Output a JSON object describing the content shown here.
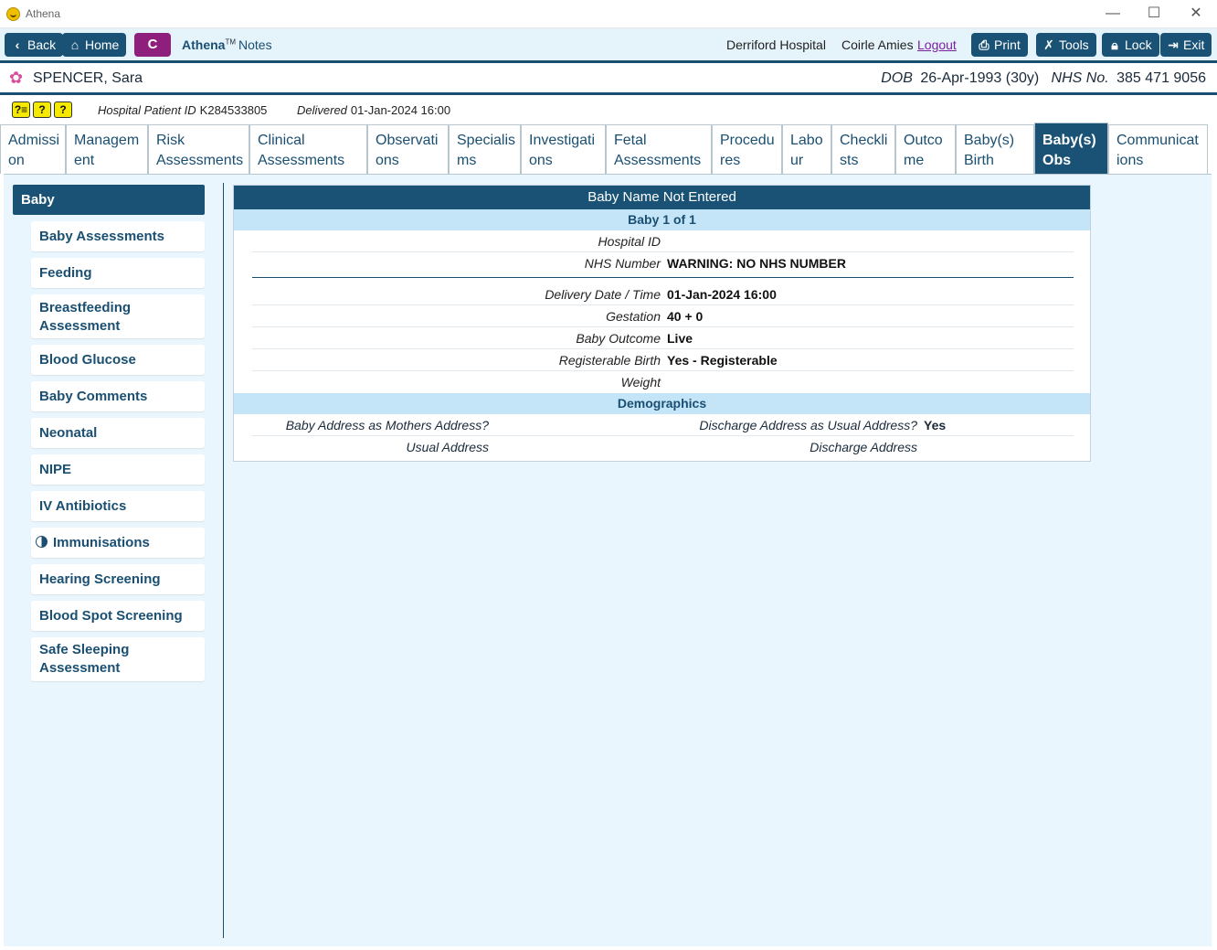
{
  "window": {
    "title": "Athena",
    "minimize": "—",
    "maximize": "☐",
    "close": "✕"
  },
  "toolbar": {
    "back": "Back",
    "home": "Home",
    "c_button": "C",
    "app_name": "Athena",
    "tm": "TM",
    "module": "Notes",
    "hospital": "Derriford Hospital",
    "user": "Coirle Amies",
    "logout": "Logout",
    "print": "Print",
    "tools": "Tools",
    "lock": "Lock",
    "exit": "Exit"
  },
  "patient": {
    "name": "SPENCER, Sara",
    "dob_label": "DOB",
    "dob": "26-Apr-1993 (30y)",
    "nhs_label": "NHS No.",
    "nhs": "385 471 9056",
    "hospital_id_label": "Hospital Patient ID",
    "hospital_id": "K284533805",
    "delivered_label": "Delivered",
    "delivered": "01-Jan-2024 16:00"
  },
  "tabs": [
    {
      "line1": "Admissi",
      "line2": "on"
    },
    {
      "line1": "Managem",
      "line2": "ent"
    },
    {
      "line1": "Risk",
      "line2": "Assessments"
    },
    {
      "line1": "Clinical",
      "line2": "Assessments"
    },
    {
      "line1": "Observati",
      "line2": "ons"
    },
    {
      "line1": "Specialis",
      "line2": "ms"
    },
    {
      "line1": "Investigati",
      "line2": "ons"
    },
    {
      "line1": "Fetal",
      "line2": "Assessments"
    },
    {
      "line1": "Procedu",
      "line2": "res"
    },
    {
      "line1": "Labo",
      "line2": "ur"
    },
    {
      "line1": "Checkli",
      "line2": "sts"
    },
    {
      "line1": "Outco",
      "line2": "me"
    },
    {
      "line1": "Baby(s)",
      "line2": "Birth"
    },
    {
      "line1": "Baby(s)",
      "line2": "Obs"
    },
    {
      "line1": "Communicat",
      "line2": "ions"
    }
  ],
  "sidebar": {
    "header": "Baby",
    "items": [
      {
        "line1": "Baby Assessments",
        "line2": ""
      },
      {
        "line1": "Feeding",
        "line2": ""
      },
      {
        "line1": "Breastfeeding",
        "line2": "Assessment"
      },
      {
        "line1": "Blood Glucose",
        "line2": ""
      },
      {
        "line1": "Baby Comments",
        "line2": ""
      },
      {
        "line1": "Neonatal",
        "line2": ""
      },
      {
        "line1": "NIPE",
        "line2": ""
      },
      {
        "line1": "IV Antibiotics",
        "line2": ""
      },
      {
        "line1": "Immunisations",
        "line2": ""
      },
      {
        "line1": "Hearing Screening",
        "line2": ""
      },
      {
        "line1": "Blood Spot Screening",
        "line2": ""
      },
      {
        "line1": "Safe Sleeping",
        "line2": "Assessment"
      }
    ]
  },
  "panel": {
    "title": "Baby Name Not Entered",
    "baby_count": "Baby 1 of  1",
    "fields": [
      {
        "label": "Hospital ID",
        "value": ""
      },
      {
        "label": "NHS Number",
        "value": "WARNING: NO NHS NUMBER"
      },
      {
        "label": "Delivery Date / Time",
        "value": "01-Jan-2024 16:00"
      },
      {
        "label": "Gestation",
        "value": "40 + 0"
      },
      {
        "label": "Baby Outcome",
        "value": "Live"
      },
      {
        "label": "Registerable Birth",
        "value": "Yes - Registerable"
      },
      {
        "label": "Weight",
        "value": ""
      }
    ],
    "demographics_header": "Demographics",
    "demographics": {
      "baby_address_label": "Baby Address as Mothers Address?",
      "discharge_same_label": "Discharge Address as Usual Address?",
      "discharge_same_value": "Yes",
      "usual_address_label": "Usual Address",
      "discharge_address_label": "Discharge Address"
    }
  }
}
